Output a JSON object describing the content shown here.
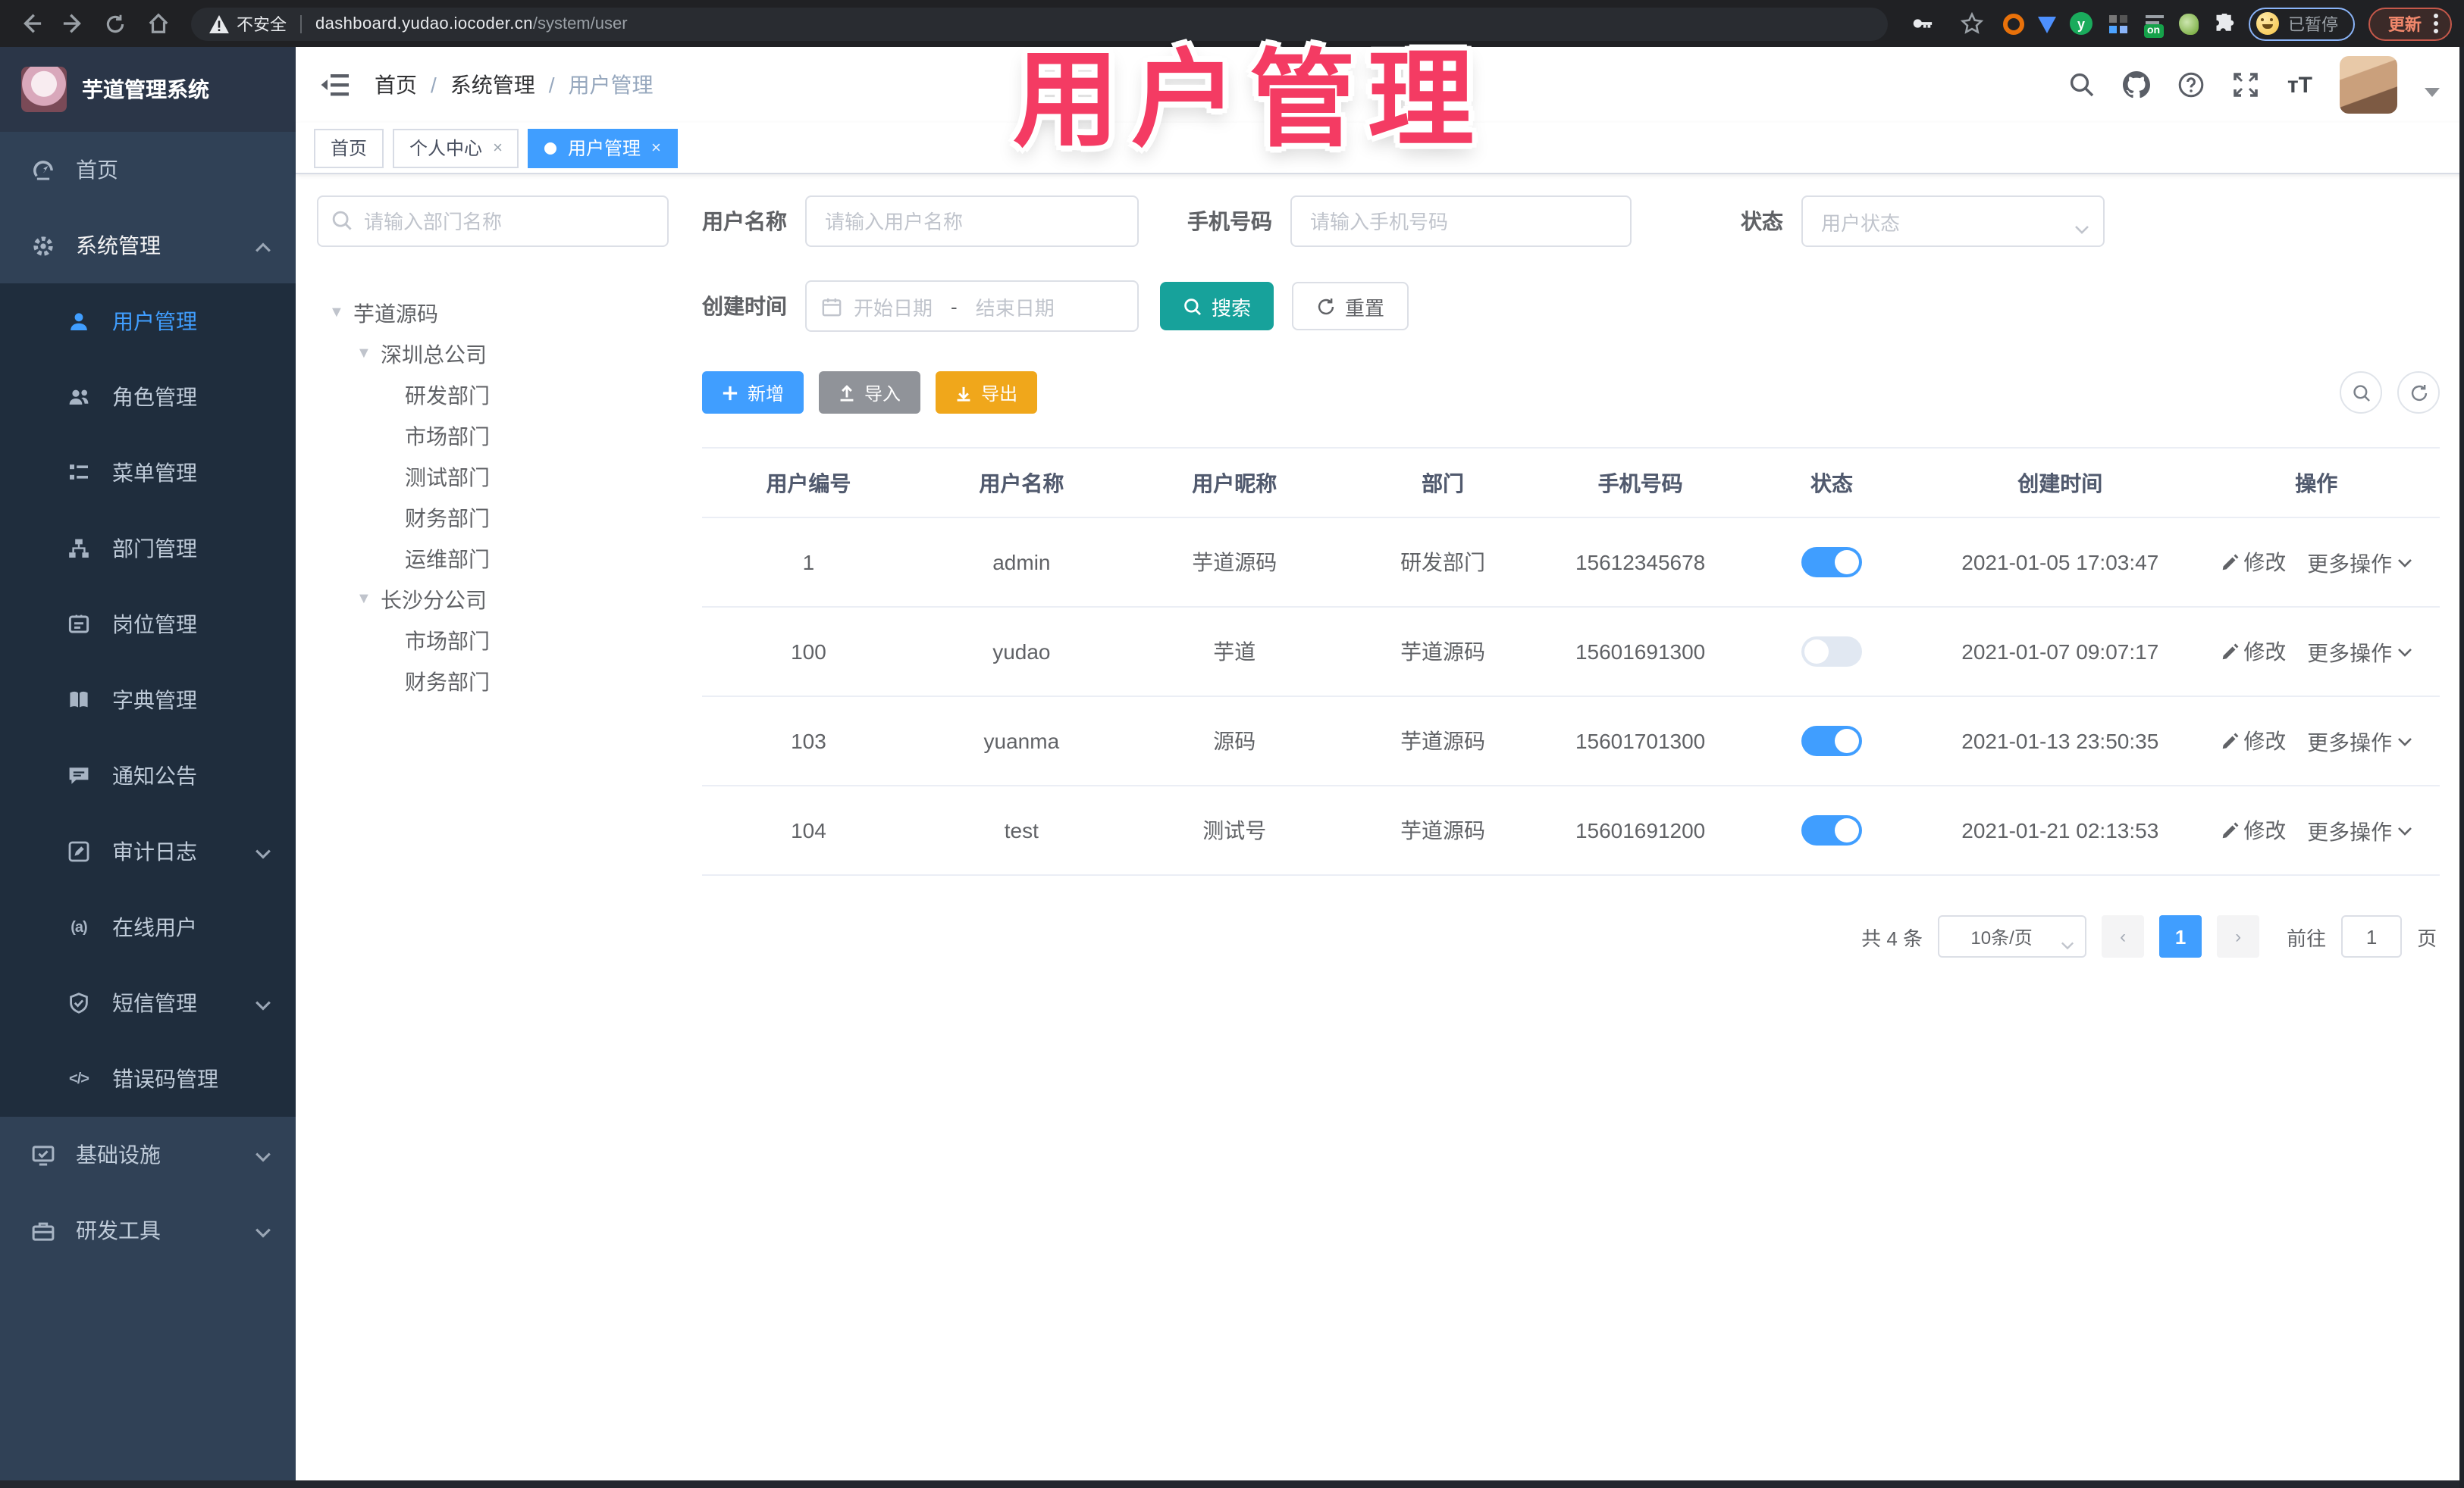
{
  "browser": {
    "security_label": "不安全",
    "url_domain": "dashboard.yudao.iocoder.cn",
    "url_path": "/system/user",
    "extension_on_text": "on",
    "extension_y_text": "y",
    "paused_label": "已暂停",
    "update_label": "更新"
  },
  "overlay_title": "用户管理",
  "sidebar": {
    "logo_title": "芋道管理系统",
    "home": "首页",
    "system": "系统管理",
    "system_children": [
      "用户管理",
      "角色管理",
      "菜单管理",
      "部门管理",
      "岗位管理",
      "字典管理",
      "通知公告",
      "审计日志",
      "在线用户",
      "短信管理",
      "错误码管理"
    ],
    "infra": "基础设施",
    "devtools": "研发工具",
    "online_icon_text": "(a)",
    "errcode_icon_text": "</>"
  },
  "header": {
    "breadcrumb": [
      "首页",
      "系统管理",
      "用户管理"
    ],
    "fontsize_icon_text": "тT",
    "help_icon_text": "?"
  },
  "tabs": {
    "items": [
      {
        "label": "首页"
      },
      {
        "label": "个人中心"
      },
      {
        "label": "用户管理"
      }
    ],
    "close_glyph": "×"
  },
  "dept_panel": {
    "search_placeholder": "请输入部门名称",
    "nodes": [
      {
        "label": "芋道源码"
      },
      {
        "label": "深圳总公司"
      },
      {
        "label": "研发部门"
      },
      {
        "label": "市场部门"
      },
      {
        "label": "测试部门"
      },
      {
        "label": "财务部门"
      },
      {
        "label": "运维部门"
      },
      {
        "label": "长沙分公司"
      },
      {
        "label": "市场部门"
      },
      {
        "label": "财务部门"
      }
    ],
    "caret_glyph": "▼"
  },
  "filters": {
    "username_label": "用户名称",
    "username_placeholder": "请输入用户名称",
    "mobile_label": "手机号码",
    "mobile_placeholder": "请输入手机号码",
    "status_label": "状态",
    "status_placeholder": "用户状态",
    "create_time_label": "创建时间",
    "date_start_placeholder": "开始日期",
    "date_separator": "-",
    "date_end_placeholder": "结束日期",
    "search_label": "搜索",
    "reset_label": "重置"
  },
  "toolbar": {
    "add_label": "新增",
    "import_label": "导入",
    "export_label": "导出"
  },
  "table": {
    "columns": [
      "用户编号",
      "用户名称",
      "用户昵称",
      "部门",
      "手机号码",
      "状态",
      "创建时间",
      "操作"
    ],
    "edit_label": "修改",
    "more_label": "更多操作",
    "rows": [
      {
        "id": "1",
        "username": "admin",
        "nickname": "芋道源码",
        "dept": "研发部门",
        "mobile": "15612345678",
        "status": true,
        "created": "2021-01-05 17:03:47"
      },
      {
        "id": "100",
        "username": "yudao",
        "nickname": "芋道",
        "dept": "芋道源码",
        "mobile": "15601691300",
        "status": false,
        "created": "2021-01-07 09:07:17"
      },
      {
        "id": "103",
        "username": "yuanma",
        "nickname": "源码",
        "dept": "芋道源码",
        "mobile": "15601701300",
        "status": true,
        "created": "2021-01-13 23:50:35"
      },
      {
        "id": "104",
        "username": "test",
        "nickname": "测试号",
        "dept": "芋道源码",
        "mobile": "15601691200",
        "status": true,
        "created": "2021-01-21 02:13:53"
      }
    ]
  },
  "pagination": {
    "total_text": "共 4 条",
    "page_size_text": "10条/页",
    "prev_glyph": "‹",
    "current_page": "1",
    "next_glyph": "›",
    "goto_label": "前往",
    "goto_value": "1",
    "page_unit": "页"
  },
  "colors": {
    "accent_blue": "#409EFF",
    "search_teal": "#17a29b",
    "export_yellow": "#f0a71b",
    "overlay_pink": "#f43b63"
  }
}
